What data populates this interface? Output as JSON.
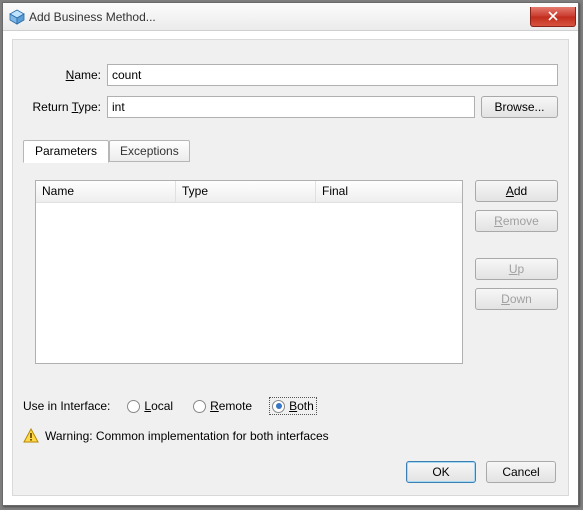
{
  "window": {
    "title": "Add Business Method..."
  },
  "fields": {
    "name_label_pre": "",
    "name_label_u": "N",
    "name_label_post": "ame:",
    "name_value": "count",
    "rtype_label_pre": "Return ",
    "rtype_label_u": "T",
    "rtype_label_post": "ype:",
    "rtype_value": "int",
    "browse": "Browse..."
  },
  "tabs": {
    "parameters": "Parameters",
    "exceptions": "Exceptions"
  },
  "table": {
    "columns": [
      "Name",
      "Type",
      "Final"
    ],
    "rows": []
  },
  "buttons": {
    "add_u": "A",
    "add_rest": "dd",
    "remove_u": "R",
    "remove_rest": "emove",
    "up_u": "U",
    "up_rest": "p",
    "down_u": "D",
    "down_rest": "own"
  },
  "interface": {
    "label": "Use in Interface:",
    "local_u": "L",
    "local_rest": "ocal",
    "remote_u": "R",
    "remote_rest": "emote",
    "both_u": "B",
    "both_rest": "oth",
    "selected": "both"
  },
  "warning": "Warning: Common implementation for both interfaces",
  "dialog": {
    "ok": "OK",
    "cancel": "Cancel"
  }
}
